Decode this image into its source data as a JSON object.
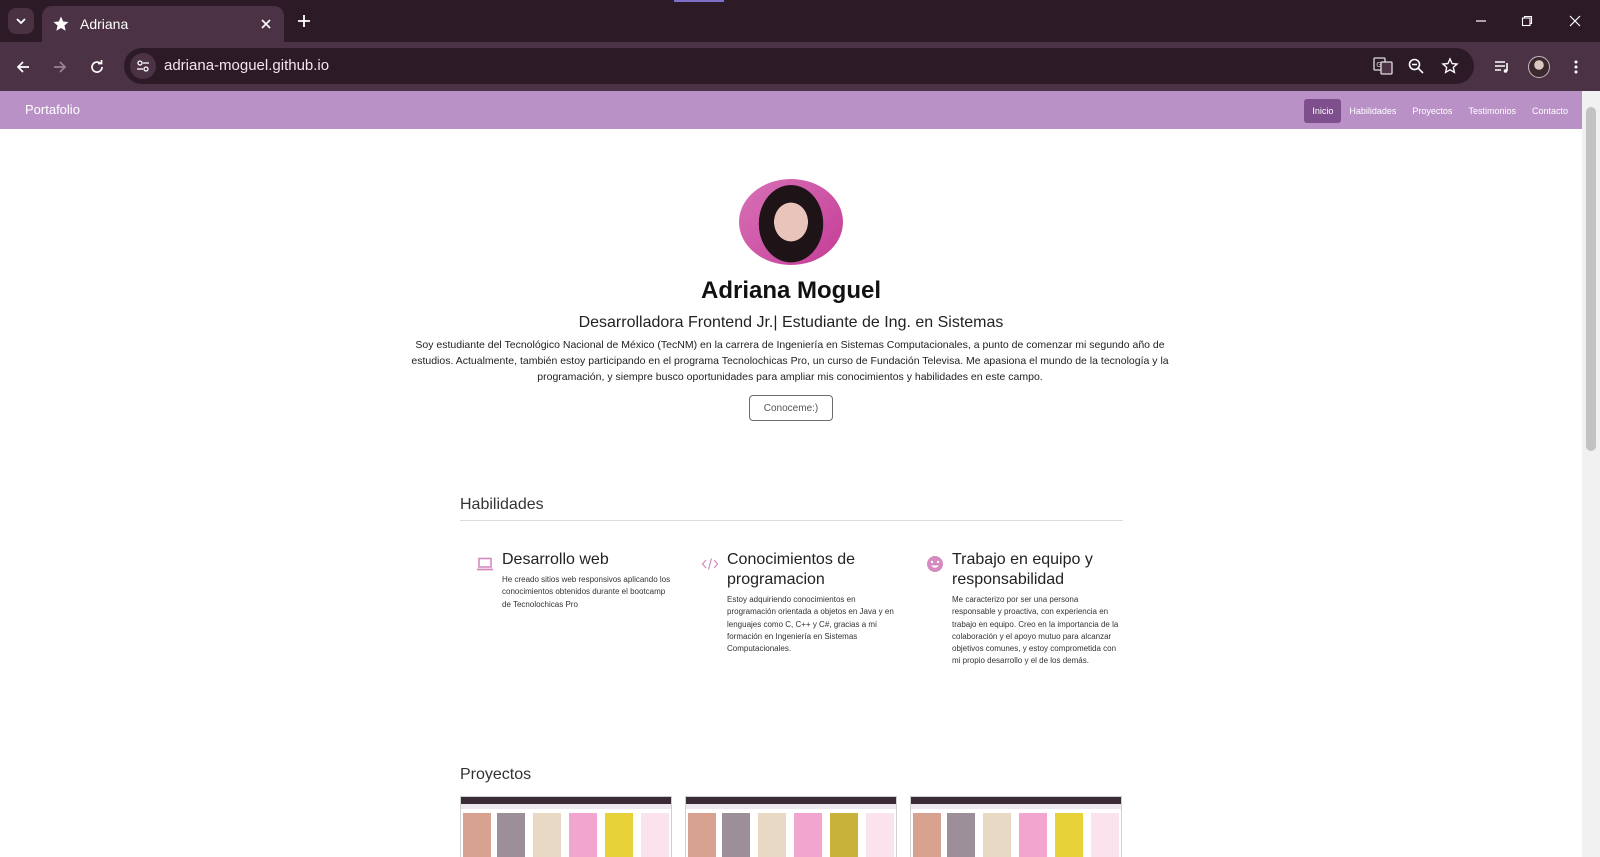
{
  "browser": {
    "tab_title": "Adriana",
    "url": "adriana-moguel.github.io"
  },
  "site": {
    "brand": "Portafolio",
    "nav": [
      "Inicio",
      "Habilidades",
      "Proyectos",
      "Testimonios",
      "Contacto"
    ],
    "active_nav": "Inicio"
  },
  "hero": {
    "name": "Adriana Moguel",
    "subtitle": "Desarrolladora Frontend Jr.| Estudiante de Ing. en Sistemas",
    "bio": "Soy estudiante del Tecnológico Nacional de México (TecNM) en la carrera de Ingeniería en Sistemas Computacionales, a punto de comenzar mi segundo año de estudios. Actualmente, también estoy participando en el programa Tecnolochicas Pro, un curso de Fundación Televisa. Me apasiona el mundo de la tecnología y la programación, y siempre busco oportunidades para ampliar mis conocimientos y habilidades en este campo.",
    "cta": "Conoceme:)"
  },
  "skills": {
    "title": "Habilidades",
    "items": [
      {
        "icon": "laptop-icon",
        "title": "Desarrollo web",
        "desc": "He creado sitios web responsivos aplicando los conocimientos obtenidos durante el bootcamp de Tecnolochicas Pro"
      },
      {
        "icon": "code-icon",
        "title": "Conocimientos de programacion",
        "desc": "Estoy adquiriendo conocimientos en programación orientada a objetos en Java y en lenguajes como C, C++ y C#, gracias a mi formación en Ingeniería en Sistemas Computacionales."
      },
      {
        "icon": "smiley-icon",
        "title": "Trabajo en equipo y responsabilidad",
        "desc": "Me caracterizo por ser una persona responsable y proactiva, con experiencia en trabajo en equipo. Creo en la importancia de la colaboración y el apoyo mutuo para alcanzar objetivos comunes, y estoy comprometida con mi propio desarrollo y el de los demás."
      }
    ]
  },
  "projects": {
    "title": "Proyectos"
  },
  "colors": {
    "nav_bg": "#b991c7",
    "nav_active": "#7f4e8d",
    "skill_icon": "#d58ac0"
  }
}
